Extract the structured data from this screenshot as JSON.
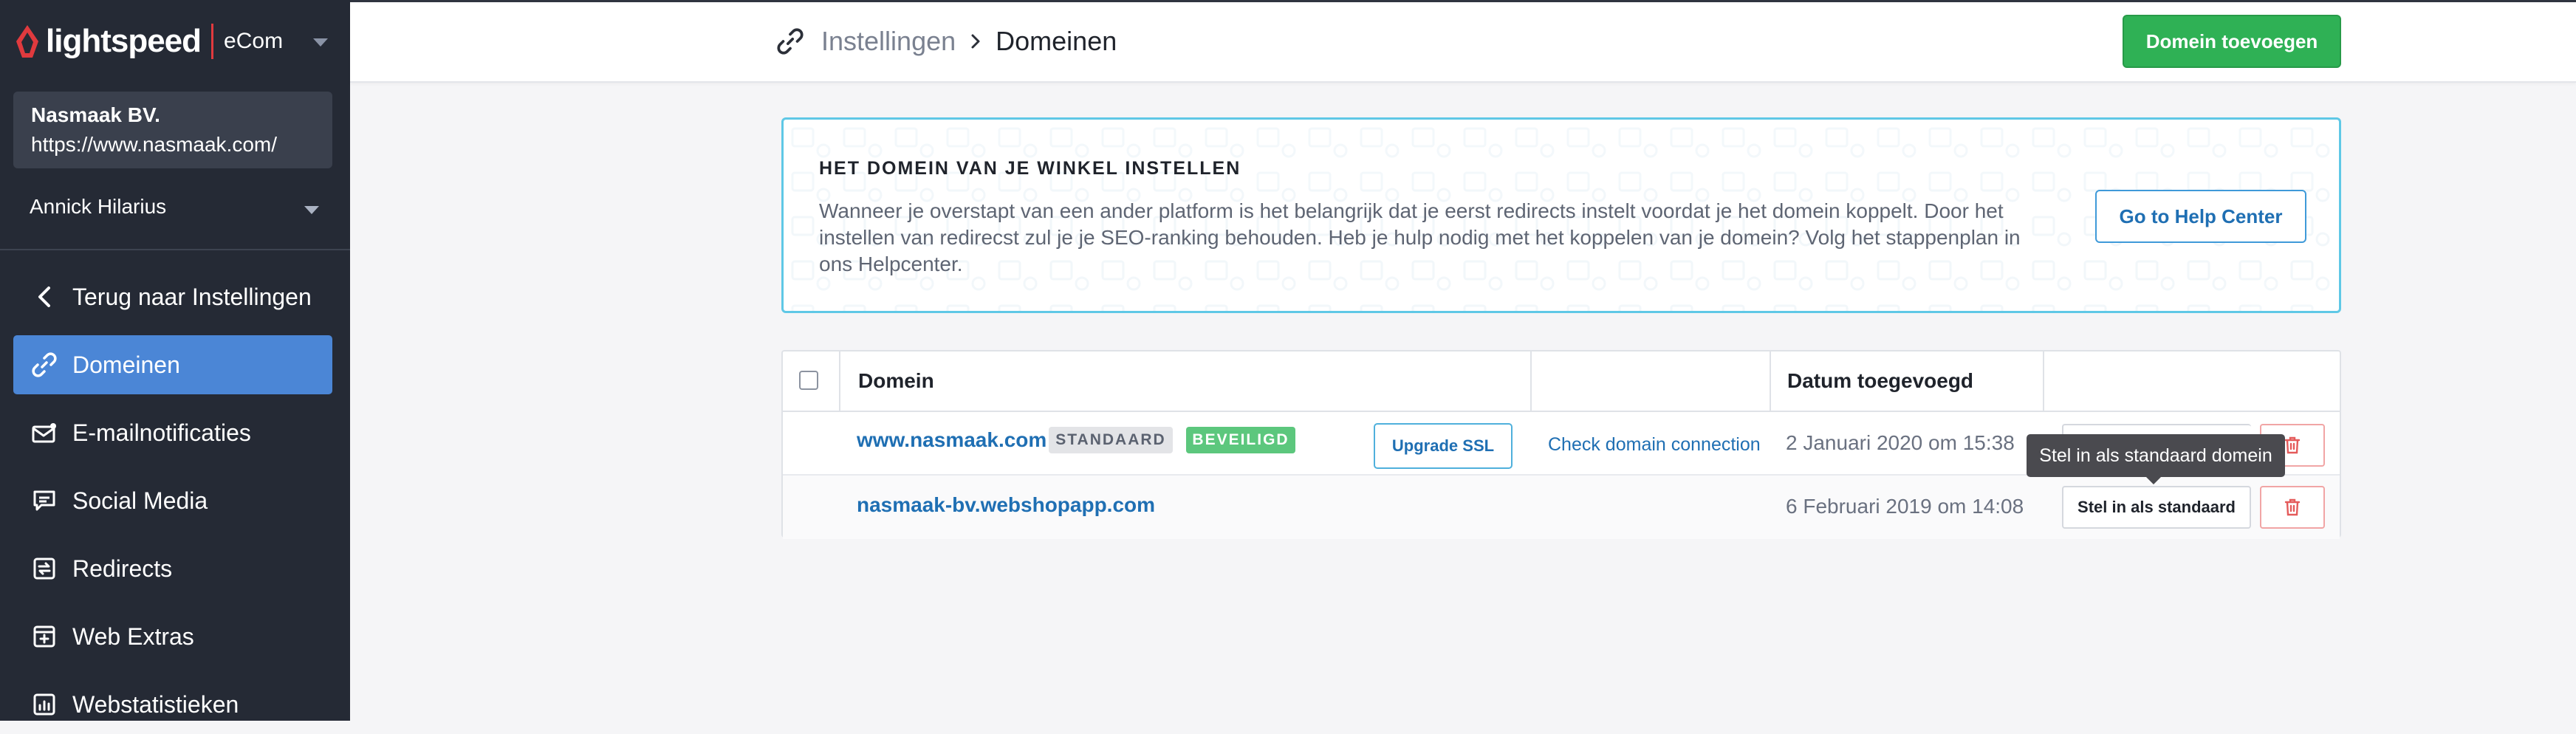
{
  "brand": {
    "name": "lightspeed",
    "product": "eCom"
  },
  "store": {
    "name": "Nasmaak BV.",
    "url": "https://www.nasmaak.com/"
  },
  "user": {
    "name": "Annick Hilarius"
  },
  "sidebar": {
    "items": [
      {
        "label": "Terug naar Instellingen",
        "icon": "back-chevron-icon"
      },
      {
        "label": "Domeinen",
        "icon": "link-icon",
        "active": true
      },
      {
        "label": "E-mailnotificaties",
        "icon": "mail-icon"
      },
      {
        "label": "Social Media",
        "icon": "chat-icon"
      },
      {
        "label": "Redirects",
        "icon": "redirect-icon"
      },
      {
        "label": "Web Extras",
        "icon": "plus-box-icon"
      },
      {
        "label": "Webstatistieken",
        "icon": "stats-icon"
      }
    ]
  },
  "header": {
    "breadcrumb_parent": "Instellingen",
    "breadcrumb_current": "Domeinen",
    "add_domain_label": "Domein toevoegen"
  },
  "info": {
    "title": "HET DOMEIN VAN JE WINKEL INSTELLEN",
    "text": "Wanneer je overstapt van een ander platform is het belangrijk dat je eerst redirects instelt voordat je het domein koppelt. Door het instellen van redirecst zul je je SEO-ranking behouden. Heb je hulp nodig met het koppelen van je domein? Volg het stappenplan in ons Helpcenter.",
    "help_button": "Go to Help Center"
  },
  "table": {
    "columns": [
      "Domein",
      "Datum toegevoegd"
    ],
    "rows": [
      {
        "domain": "www.nasmaak.com",
        "badges": [
          "STANDAARD",
          "BEVEILIGD"
        ],
        "ssl_button": "Upgrade SSL",
        "check_link": "Check domain connection",
        "date": "2 Januari 2020 om 15:38"
      },
      {
        "domain": "nasmaak-bv.webshopapp.com",
        "date": "6 Februari 2019 om 14:08",
        "set_default_button": "Stel in als standaard"
      }
    ]
  },
  "tooltip": {
    "text": "Stel in als standaard domein"
  },
  "colors": {
    "sidebar_bg": "#252a35",
    "active_item": "#4b86d6",
    "primary_green": "#2fb155",
    "link_blue": "#1f6fb3",
    "badge_secure": "#5cc77d",
    "info_border": "#5fc8e6",
    "brand_red": "#e03a3e"
  }
}
